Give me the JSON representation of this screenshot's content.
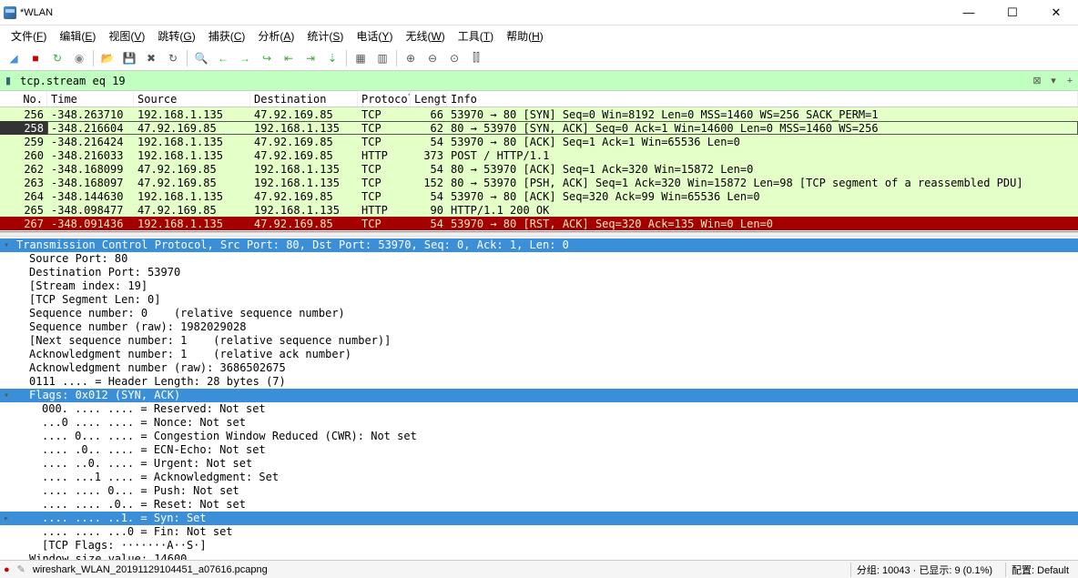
{
  "title": "*WLAN",
  "menu": [
    "文件(F)",
    "编辑(E)",
    "视图(V)",
    "跳转(G)",
    "捕获(C)",
    "分析(A)",
    "统计(S)",
    "电话(Y)",
    "无线(W)",
    "工具(T)",
    "帮助(H)"
  ],
  "filter": "tcp.stream eq 19",
  "cols": [
    "No.",
    "Time",
    "Source",
    "Destination",
    "Protocol",
    "Length",
    "Info"
  ],
  "packets": [
    {
      "no": "256",
      "time": "-348.263710",
      "src": "192.168.1.135",
      "dst": "47.92.169.85",
      "proto": "TCP",
      "len": "66",
      "info": "53970 → 80 [SYN] Seq=0 Win=8192 Len=0 MSS=1460 WS=256 SACK_PERM=1",
      "cls": "bg-green"
    },
    {
      "no": "258",
      "time": "-348.216604",
      "src": "47.92.169.85",
      "dst": "192.168.1.135",
      "proto": "TCP",
      "len": "62",
      "info": "80 → 53970 [SYN, ACK] Seq=0 Ack=1 Win=14600 Len=0 MSS=1460 WS=256",
      "cls": "bg-sel"
    },
    {
      "no": "259",
      "time": "-348.216424",
      "src": "192.168.1.135",
      "dst": "47.92.169.85",
      "proto": "TCP",
      "len": "54",
      "info": "53970 → 80 [ACK] Seq=1 Ack=1 Win=65536 Len=0",
      "cls": "bg-green"
    },
    {
      "no": "260",
      "time": "-348.216033",
      "src": "192.168.1.135",
      "dst": "47.92.169.85",
      "proto": "HTTP",
      "len": "373",
      "info": "POST / HTTP/1.1",
      "cls": "bg-green"
    },
    {
      "no": "262",
      "time": "-348.168099",
      "src": "47.92.169.85",
      "dst": "192.168.1.135",
      "proto": "TCP",
      "len": "54",
      "info": "80 → 53970 [ACK] Seq=1 Ack=320 Win=15872 Len=0",
      "cls": "bg-green"
    },
    {
      "no": "263",
      "time": "-348.168097",
      "src": "47.92.169.85",
      "dst": "192.168.1.135",
      "proto": "TCP",
      "len": "152",
      "info": "80 → 53970 [PSH, ACK] Seq=1 Ack=320 Win=15872 Len=98 [TCP segment of a reassembled PDU]",
      "cls": "bg-green"
    },
    {
      "no": "264",
      "time": "-348.144630",
      "src": "192.168.1.135",
      "dst": "47.92.169.85",
      "proto": "TCP",
      "len": "54",
      "info": "53970 → 80 [ACK] Seq=320 Ack=99 Win=65536 Len=0",
      "cls": "bg-green"
    },
    {
      "no": "265",
      "time": "-348.098477",
      "src": "47.92.169.85",
      "dst": "192.168.1.135",
      "proto": "HTTP",
      "len": "90",
      "info": "HTTP/1.1 200 OK",
      "cls": "bg-green"
    },
    {
      "no": "267",
      "time": "-348.091436",
      "src": "192.168.1.135",
      "dst": "47.92.169.85",
      "proto": "TCP",
      "len": "54",
      "info": "53970 → 80 [RST, ACK] Seq=320 Ack=135 Win=0 Len=0",
      "cls": "bg-red"
    }
  ],
  "details": [
    {
      "t": "Transmission Control Protocol, Src Port: 80, Dst Port: 53970, Seq: 0, Ack: 1, Len: 0",
      "cls": "sel hassub",
      "i": 0
    },
    {
      "t": "Source Port: 80",
      "i": 1
    },
    {
      "t": "Destination Port: 53970",
      "i": 1
    },
    {
      "t": "[Stream index: 19]",
      "i": 1
    },
    {
      "t": "[TCP Segment Len: 0]",
      "i": 1
    },
    {
      "t": "Sequence number: 0    (relative sequence number)",
      "i": 1
    },
    {
      "t": "Sequence number (raw): 1982029028",
      "i": 1
    },
    {
      "t": "[Next sequence number: 1    (relative sequence number)]",
      "i": 1
    },
    {
      "t": "Acknowledgment number: 1    (relative ack number)",
      "i": 1
    },
    {
      "t": "Acknowledgment number (raw): 3686502675",
      "i": 1
    },
    {
      "t": "0111 .... = Header Length: 28 bytes (7)",
      "i": 1
    },
    {
      "t": "Flags: 0x012 (SYN, ACK)",
      "cls": "sel hassub",
      "i": 1
    },
    {
      "t": "000. .... .... = Reserved: Not set",
      "i": 2
    },
    {
      "t": "...0 .... .... = Nonce: Not set",
      "i": 2
    },
    {
      "t": ".... 0... .... = Congestion Window Reduced (CWR): Not set",
      "i": 2
    },
    {
      "t": ".... .0.. .... = ECN-Echo: Not set",
      "i": 2
    },
    {
      "t": ".... ..0. .... = Urgent: Not set",
      "i": 2
    },
    {
      "t": ".... ...1 .... = Acknowledgment: Set",
      "i": 2
    },
    {
      "t": ".... .... 0... = Push: Not set",
      "i": 2
    },
    {
      "t": ".... .... .0.. = Reset: Not set",
      "i": 2
    },
    {
      "t": ".... .... ..1. = Syn: Set",
      "cls": "sel hassub collapsed",
      "i": 2
    },
    {
      "t": ".... .... ...0 = Fin: Not set",
      "i": 2
    },
    {
      "t": "[TCP Flags: ·······A··S·]",
      "i": 2
    },
    {
      "t": "Window size value: 14600",
      "i": 1
    }
  ],
  "status": {
    "file": "wireshark_WLAN_20191129104451_a07616.pcapng",
    "pkts": "分组: 10043 · 已显示: 9 (0.1%)",
    "profile": "配置: Default"
  }
}
